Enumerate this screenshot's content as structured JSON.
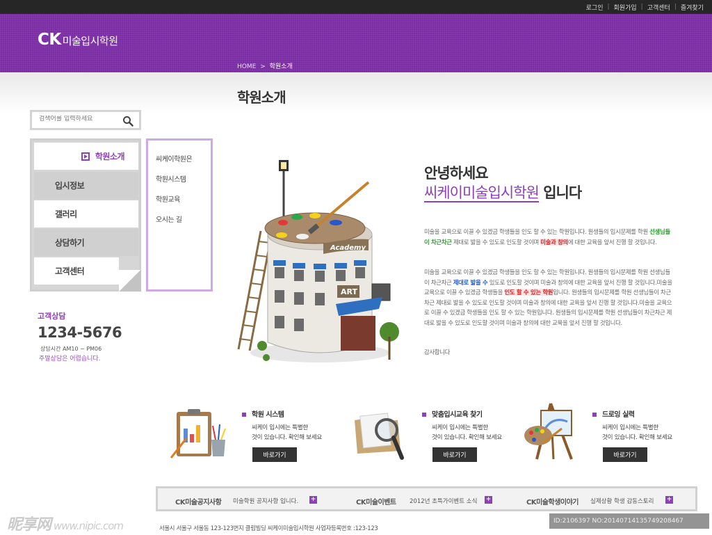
{
  "util_nav": [
    "로그인",
    "회원가입",
    "고객센터",
    "즐겨찾기"
  ],
  "logo": {
    "bold": "CK",
    "text": "미술입시학원"
  },
  "breadcrumb": {
    "home": "HOME",
    "sep": ">",
    "current": "학원소개"
  },
  "page_title": "학원소개",
  "search": {
    "placeholder": "검색어를 입력하세요"
  },
  "left_menu": [
    "학원소개",
    "입시정보",
    "갤러리",
    "상담하기",
    "고객센터"
  ],
  "sub_menu": [
    "씨케이학원은",
    "학원시스템",
    "학원교육",
    "오시는 길"
  ],
  "contact": {
    "title": "고객상담",
    "phone": "1234-5676",
    "hours": "상담시간 AM10 ~ PM06",
    "note": "주말상담은 어렵습니다."
  },
  "building": {
    "sign1": "Academy",
    "sign2": "ART"
  },
  "greeting": {
    "line1": "안녕하세요",
    "academy": "씨케이미술입시학원",
    "end": " 입니다"
  },
  "para1": {
    "a": "미술을 교육으로 이끌 수 있겠금 학생들을 인도 할 수 있는 학원입니다. 원생들의 입시문제를 학원 ",
    "h1": "선생님들이 차근차근",
    "b": " 제대로 밟을 수 있도로 인도할 것이며 ",
    "h2": "미술과 창의",
    "c": "에 대한 교육을 앞서 진행 할 것입니다."
  },
  "para2": {
    "a": "미술을 교육으로 이끌 수 있겠금 학생들을 인도 할 수 있는 학원입니다. 원생들의 입시문제를 학원 선생님들이 차근차근 ",
    "h1": "제대로 밟을 수",
    "b": " 있도로 인도할 것이며 미술과 창의에 대한 교육을 앞서 진행 할 것입니다.미술을 교육으로 이끌 수 있겠금 학생들을 ",
    "h2": "인도 할 수 있는 학원",
    "c": "입니다. 원생들의 입시문제를 학원 선생님들이 차근차근 제대로 밟을 수 있도로 인도할 것이며 미술과 창의에 대한 교육을 앞서 진행 할 것입니다.미술을 교육으로 이끌 수 있겠금 학생들을 인도 할 수 있는 학원입니다. 원생들의 입시문제를 학원 선생님들이 차근차근 제대로 밟을 수 있도로 인도할 것이며 미술과 창의에 대한 교육을 앞서 진행 할 것입니다."
  },
  "thanks": "감사합니다",
  "features": [
    {
      "title": "학원 시스템",
      "desc1": "씨케이 입시에는 특별한",
      "desc2": "것이 있습니다. 확인해 보세요",
      "button": "바로가기",
      "icon": "clipboard-icon"
    },
    {
      "title": "맞춤입시교육 찾기",
      "desc1": "씨케이 입시에는 특별한",
      "desc2": "것이 있습니다. 확인해 보세요",
      "button": "바로가기",
      "icon": "magnifier-folder-icon"
    },
    {
      "title": "드로잉 실력",
      "desc1": "씨케이 입시에는 특별한",
      "desc2": "것이 있습니다. 확인해 보세요",
      "button": "바로가기",
      "icon": "easel-palette-icon"
    }
  ],
  "notices": [
    {
      "title": "CK미술공지사항",
      "text": "미술학원 공지사항 입니다."
    },
    {
      "title": "CK미술이벤트",
      "text": "2012년 초특가이벤트 소식"
    },
    {
      "title": "CK미술학생이야기",
      "text": "실제상황 학생 감동스토리"
    }
  ],
  "plus": "+",
  "footer": "서울시 서울구 서울동 123-123번지 클립빌딩 씨케이미술입시학원 사업자등록번호 :123-123",
  "watermark_left": {
    "main": "昵享网",
    "url": "www.nipic.com"
  },
  "watermark_right": "ID:2106397 NO:20140714135749208467"
}
